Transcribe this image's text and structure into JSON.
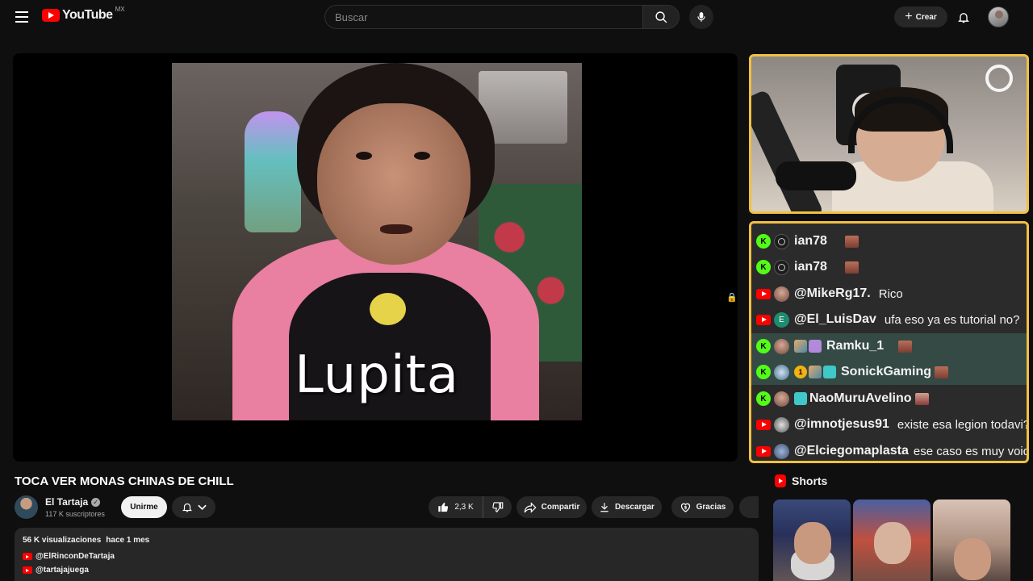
{
  "header": {
    "logo_text": "YouTube",
    "logo_region": "MX",
    "search_placeholder": "Buscar",
    "create_label": "Crear"
  },
  "video": {
    "caption": "Lupita"
  },
  "chat": {
    "messages": [
      {
        "platform": "kick",
        "user": "ian78",
        "message": "",
        "emote": true
      },
      {
        "platform": "kick",
        "user": "ian78",
        "message": "",
        "emote": true
      },
      {
        "platform": "youtube",
        "user": "@MikeRg17.",
        "message": "Rico",
        "emote": false
      },
      {
        "platform": "youtube",
        "user": "@El_LuisDav",
        "avatar_letter": "E",
        "message": "ufa eso ya es tutorial no?",
        "emote": false
      },
      {
        "platform": "kick",
        "user": "Ramku_1",
        "message": "",
        "emote": true,
        "highlight": true
      },
      {
        "platform": "kick",
        "user": "SonickGaming",
        "badge_number": "1",
        "message": "",
        "emote": true,
        "highlight": true
      },
      {
        "platform": "kick",
        "user": "NaoMuruAvelino",
        "message": "",
        "emote": true
      },
      {
        "platform": "youtube",
        "user": "@imnotjesus91",
        "message": "existe esa legion todavi?",
        "emote": false
      },
      {
        "platform": "youtube",
        "user": "@Elciegomaplasta",
        "message": "ese caso es muy void",
        "emote": false
      }
    ]
  },
  "video_info": {
    "title": "TOCA VER MONAS CHINAS DE CHILL",
    "channel_name": "El Tartaja",
    "subscribers": "117 K suscriptores",
    "join_label": "Unirme",
    "likes": "2,3 K",
    "share_label": "Compartir",
    "download_label": "Descargar",
    "thanks_label": "Gracias"
  },
  "description": {
    "views": "56 K visualizaciones",
    "date": "hace 1 mes",
    "links": [
      "@ElRinconDeTartaja",
      "@tartajajuega"
    ]
  },
  "shorts": {
    "heading": "Shorts"
  },
  "colors": {
    "background": "#0f0f0f",
    "overlay_border": "#f0c040",
    "kick_green": "#53fc18",
    "youtube_red": "#ff0000"
  }
}
